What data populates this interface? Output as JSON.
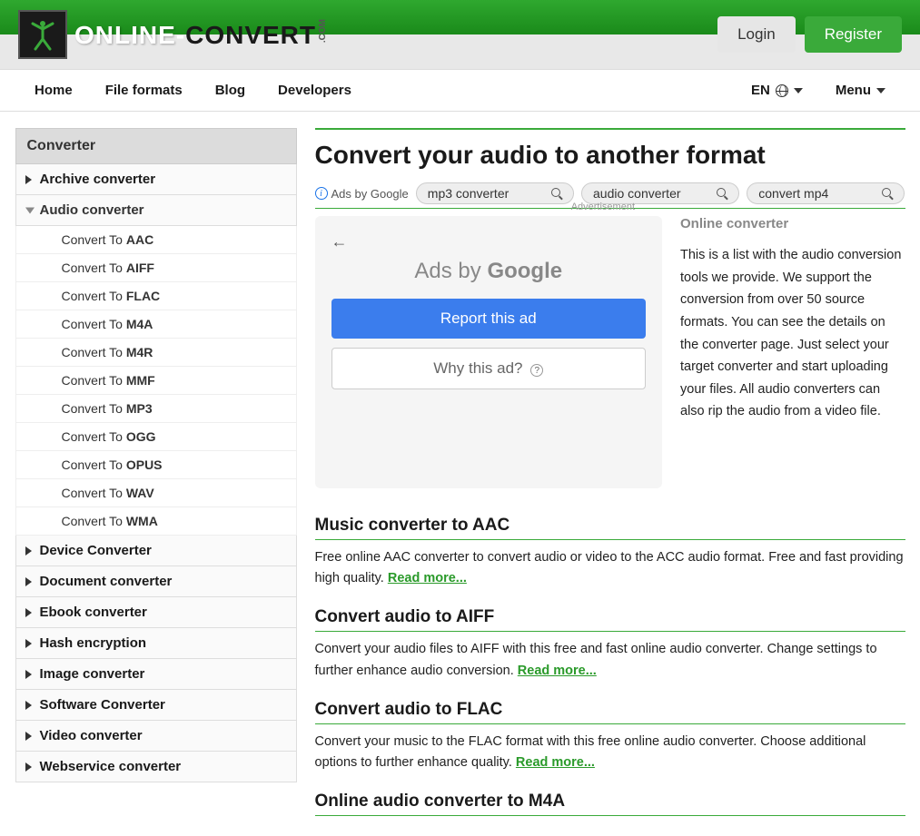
{
  "header": {
    "logo_online": "ONLINE",
    "logo_dash": "-",
    "logo_convert": "CONVERT",
    "logo_com": ".COM",
    "login": "Login",
    "register": "Register"
  },
  "nav": {
    "home": "Home",
    "file_formats": "File formats",
    "blog": "Blog",
    "developers": "Developers",
    "lang": "EN",
    "menu": "Menu"
  },
  "sidebar": {
    "head": "Converter",
    "cats": [
      {
        "label": "Archive converter"
      },
      {
        "label": "Audio converter"
      },
      {
        "label": "Device Converter"
      },
      {
        "label": "Document converter"
      },
      {
        "label": "Ebook converter"
      },
      {
        "label": "Hash encryption"
      },
      {
        "label": "Image converter"
      },
      {
        "label": "Software Converter"
      },
      {
        "label": "Video converter"
      },
      {
        "label": "Webservice converter"
      }
    ],
    "audio_prefix": "Convert To ",
    "audio_subs": [
      "AAC",
      "AIFF",
      "FLAC",
      "M4A",
      "M4R",
      "MMF",
      "MP3",
      "OGG",
      "OPUS",
      "WAV",
      "WMA"
    ]
  },
  "page": {
    "title": "Convert your audio to another format",
    "ads_by": "Ads by Google",
    "pills": [
      "mp3 converter",
      "audio converter",
      "convert mp4"
    ],
    "ad_label": "Advertisement",
    "ads_google_a": "Ads by ",
    "ads_google_b": "Google",
    "report": "Report this ad",
    "why": "Why this ad?",
    "desc_head": "Online converter",
    "desc_text": "This is a list with the audio conversion tools we provide. We support the conversion from over 50 source formats. You can see the details on the converter page. Just select your target converter and start uploading your files. All audio converters can also rip the audio from a video file.",
    "read_more": "Read more...",
    "items": [
      {
        "title": "Music converter to AAC",
        "desc": "Free online AAC converter to convert audio or video to the ACC audio format. Free and fast providing high quality. "
      },
      {
        "title": "Convert audio to AIFF",
        "desc": "Convert your audio files to AIFF with this free and fast online audio converter. Change settings to further enhance audio conversion. "
      },
      {
        "title": "Convert audio to FLAC",
        "desc": "Convert your music to the FLAC format with this free online audio converter. Choose additional options to further enhance quality. "
      },
      {
        "title": "Online audio converter to M4A",
        "desc": ""
      }
    ]
  }
}
